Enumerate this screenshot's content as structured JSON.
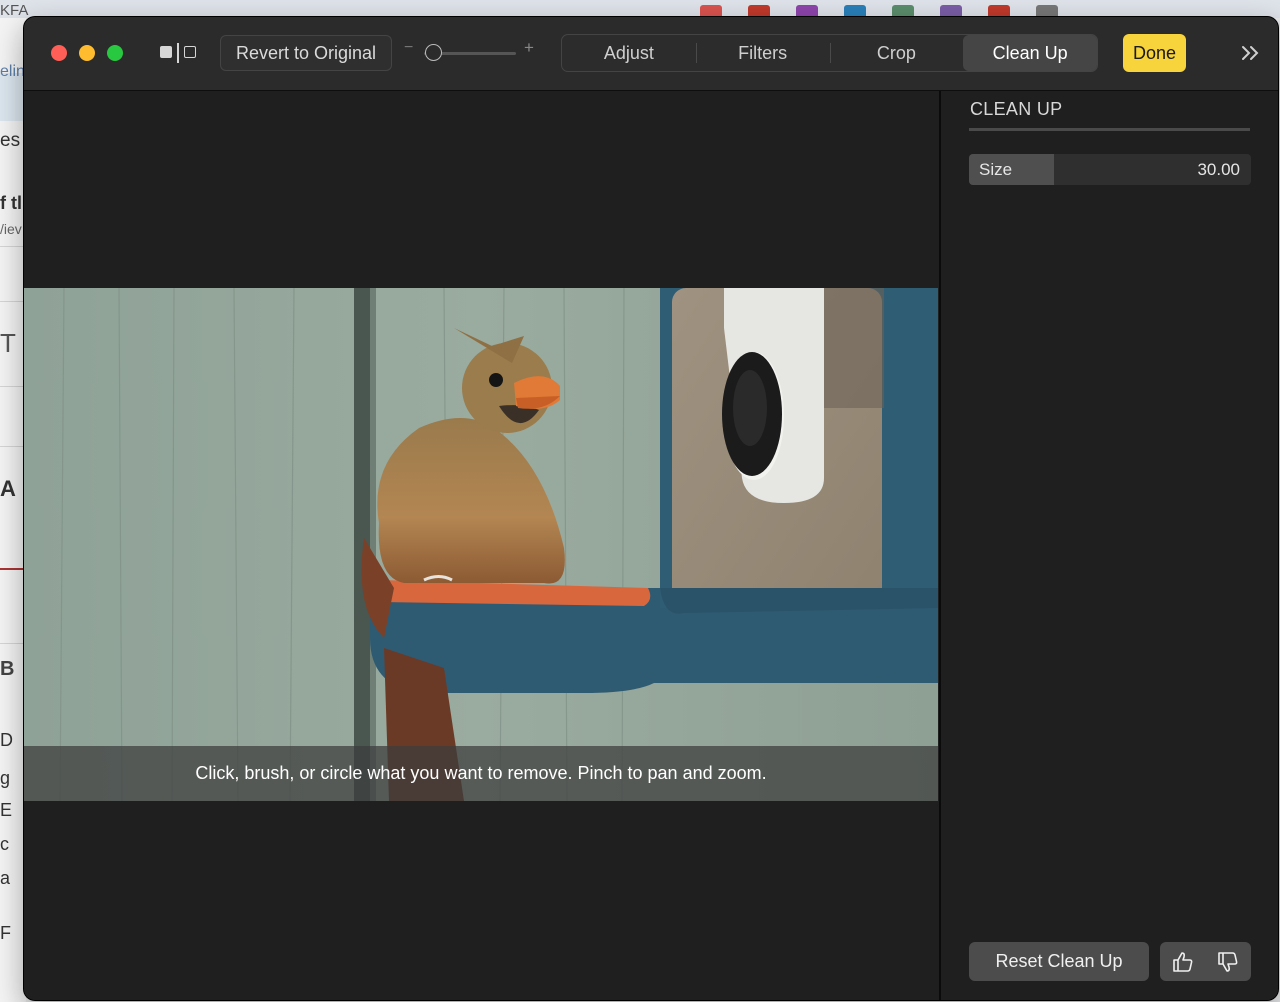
{
  "toolbar": {
    "revert_label": "Revert to Original",
    "zoom_minus": "−",
    "zoom_plus": "+",
    "zoom_level": 0.03,
    "tabs": [
      {
        "label": "Adjust",
        "active": false
      },
      {
        "label": "Filters",
        "active": false
      },
      {
        "label": "Crop",
        "active": false
      },
      {
        "label": "Clean Up",
        "active": true
      }
    ],
    "done_label": "Done",
    "more_icon": "chevron-double-right-icon"
  },
  "canvas": {
    "hint": "Click, brush, or circle what you want to remove. Pinch to pan and zoom."
  },
  "sidebar": {
    "title": "CLEAN UP",
    "size_label": "Size",
    "size_value": "30.00",
    "size_fraction": 0.3,
    "reset_label": "Reset Clean Up",
    "thumbs_up_icon": "thumbs-up-icon",
    "thumbs_down_icon": "thumbs-down-icon"
  },
  "colors": {
    "accent_done": "#f7d33c",
    "traffic_close": "#ff5f57",
    "traffic_min": "#febc2e",
    "traffic_max": "#28c840"
  },
  "background": {
    "fragments": [
      "KFA",
      "elin",
      "es",
      "f tl",
      "/iev",
      "T",
      "A",
      "B",
      "D",
      "g",
      "E",
      "c",
      "a",
      "F"
    ]
  }
}
